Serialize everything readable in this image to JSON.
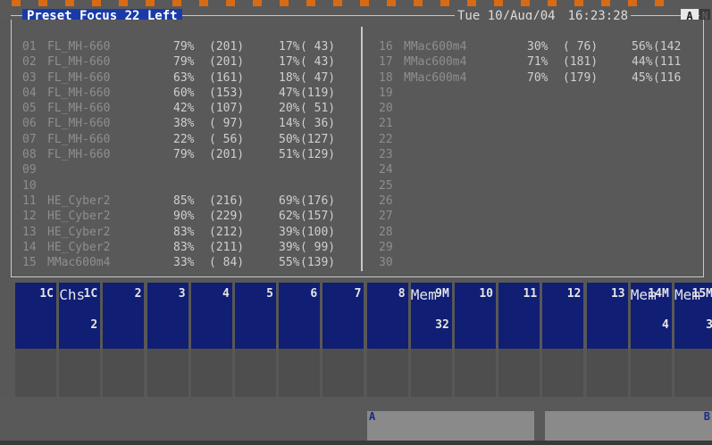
{
  "header": {
    "title": "Preset Focus 22 Left",
    "date": "Tue 10/Aug/04",
    "time": "16:23:28",
    "user": "A",
    "user_alt": "N"
  },
  "left_channels": [
    {
      "num": "01",
      "name": "FL_MH-660",
      "v1": "79%",
      "d1": "(201)",
      "v2": "17%",
      "d2": "( 43)"
    },
    {
      "num": "02",
      "name": "FL_MH-660",
      "v1": "79%",
      "d1": "(201)",
      "v2": "17%",
      "d2": "( 43)"
    },
    {
      "num": "03",
      "name": "FL_MH-660",
      "v1": "63%",
      "d1": "(161)",
      "v2": "18%",
      "d2": "( 47)"
    },
    {
      "num": "04",
      "name": "FL_MH-660",
      "v1": "60%",
      "d1": "(153)",
      "v2": "47%",
      "d2": "(119)"
    },
    {
      "num": "05",
      "name": "FL_MH-660",
      "v1": "42%",
      "d1": "(107)",
      "v2": "20%",
      "d2": "( 51)"
    },
    {
      "num": "06",
      "name": "FL_MH-660",
      "v1": "38%",
      "d1": "( 97)",
      "v2": "14%",
      "d2": "( 36)"
    },
    {
      "num": "07",
      "name": "FL_MH-660",
      "v1": "22%",
      "d1": "( 56)",
      "v2": "50%",
      "d2": "(127)"
    },
    {
      "num": "08",
      "name": "FL_MH-660",
      "v1": "79%",
      "d1": "(201)",
      "v2": "51%",
      "d2": "(129)"
    },
    {
      "num": "09",
      "name": "",
      "v1": "",
      "d1": "",
      "v2": "",
      "d2": ""
    },
    {
      "num": "10",
      "name": "",
      "v1": "",
      "d1": "",
      "v2": "",
      "d2": ""
    },
    {
      "num": "11",
      "name": "HE_Cyber2",
      "v1": "85%",
      "d1": "(216)",
      "v2": "69%",
      "d2": "(176)"
    },
    {
      "num": "12",
      "name": "HE_Cyber2",
      "v1": "90%",
      "d1": "(229)",
      "v2": "62%",
      "d2": "(157)"
    },
    {
      "num": "13",
      "name": "HE_Cyber2",
      "v1": "83%",
      "d1": "(212)",
      "v2": "39%",
      "d2": "(100)"
    },
    {
      "num": "14",
      "name": "HE_Cyber2",
      "v1": "83%",
      "d1": "(211)",
      "v2": "39%",
      "d2": "( 99)"
    },
    {
      "num": "15",
      "name": "MMac600m4",
      "v1": "33%",
      "d1": "( 84)",
      "v2": "55%",
      "d2": "(139)"
    }
  ],
  "right_channels": [
    {
      "num": "16",
      "name": "MMac600m4",
      "v1": "30%",
      "d1": "( 76)",
      "v2": "56%",
      "d2": "(142"
    },
    {
      "num": "17",
      "name": "MMac600m4",
      "v1": "71%",
      "d1": "(181)",
      "v2": "44%",
      "d2": "(111"
    },
    {
      "num": "18",
      "name": "MMac600m4",
      "v1": "70%",
      "d1": "(179)",
      "v2": "45%",
      "d2": "(116"
    },
    {
      "num": "19",
      "name": "",
      "v1": "",
      "d1": "",
      "v2": "",
      "d2": ""
    },
    {
      "num": "20",
      "name": "",
      "v1": "",
      "d1": "",
      "v2": "",
      "d2": ""
    },
    {
      "num": "21",
      "name": "",
      "v1": "",
      "d1": "",
      "v2": "",
      "d2": ""
    },
    {
      "num": "22",
      "name": "",
      "v1": "",
      "d1": "",
      "v2": "",
      "d2": ""
    },
    {
      "num": "23",
      "name": "",
      "v1": "",
      "d1": "",
      "v2": "",
      "d2": ""
    },
    {
      "num": "24",
      "name": "",
      "v1": "",
      "d1": "",
      "v2": "",
      "d2": ""
    },
    {
      "num": "25",
      "name": "",
      "v1": "",
      "d1": "",
      "v2": "",
      "d2": ""
    },
    {
      "num": "26",
      "name": "",
      "v1": "",
      "d1": "",
      "v2": "",
      "d2": ""
    },
    {
      "num": "27",
      "name": "",
      "v1": "",
      "d1": "",
      "v2": "",
      "d2": ""
    },
    {
      "num": "28",
      "name": "",
      "v1": "",
      "d1": "",
      "v2": "",
      "d2": ""
    },
    {
      "num": "29",
      "name": "",
      "v1": "",
      "d1": "",
      "v2": "",
      "d2": ""
    },
    {
      "num": "30",
      "name": "",
      "v1": "",
      "d1": "",
      "v2": "",
      "d2": ""
    }
  ],
  "tiles": [
    {
      "num": "1C",
      "label": "",
      "sub": ""
    },
    {
      "num": "1C",
      "label": "Chs",
      "sub": "2"
    },
    {
      "num": "2",
      "label": "",
      "sub": ""
    },
    {
      "num": "3",
      "label": "",
      "sub": ""
    },
    {
      "num": "4",
      "label": "",
      "sub": ""
    },
    {
      "num": "5",
      "label": "",
      "sub": ""
    },
    {
      "num": "6",
      "label": "",
      "sub": ""
    },
    {
      "num": "7",
      "label": "",
      "sub": ""
    },
    {
      "num": "8",
      "label": "",
      "sub": ""
    },
    {
      "num": "9M",
      "label": "Mem",
      "sub": "32"
    },
    {
      "num": "10",
      "label": "",
      "sub": ""
    },
    {
      "num": "11",
      "label": "",
      "sub": ""
    },
    {
      "num": "12",
      "label": "",
      "sub": ""
    },
    {
      "num": "13",
      "label": "",
      "sub": ""
    },
    {
      "num": "14M",
      "label": "Mem",
      "sub": "4"
    },
    {
      "num": "15M",
      "label": "Mem",
      "sub": "3"
    }
  ],
  "faders": {
    "a_label": "A",
    "b_label": "B"
  }
}
